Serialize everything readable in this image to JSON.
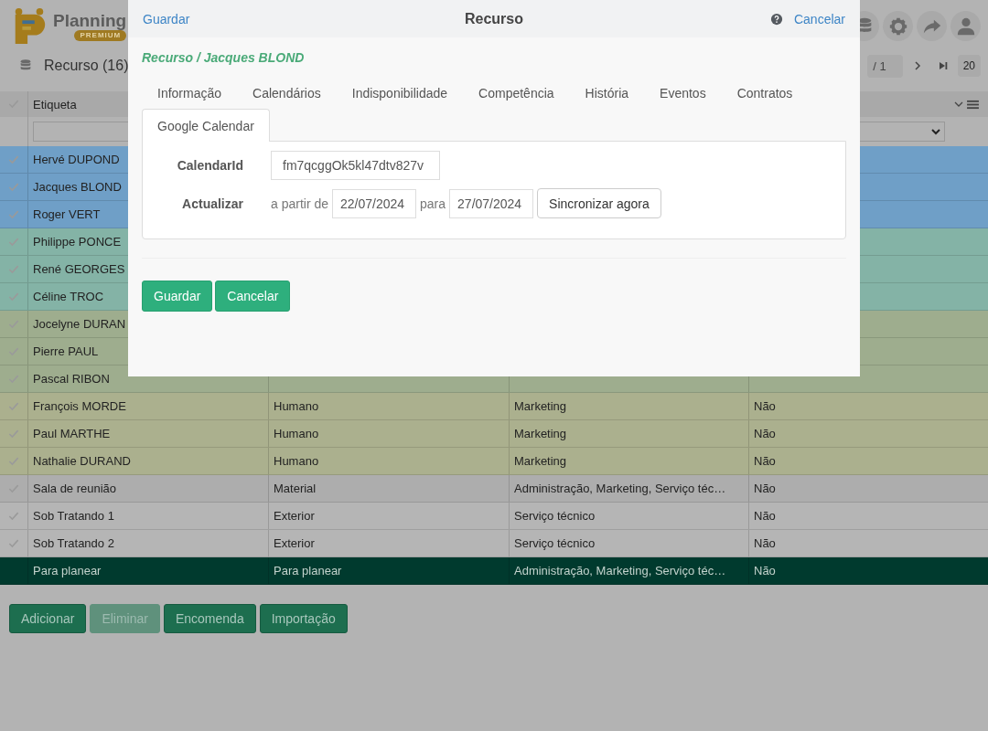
{
  "app": {
    "logo_name": "Planning",
    "logo_badge": "PREMIUM"
  },
  "toolbar": {
    "title": "Recurso (16)",
    "page_total": "/ 1",
    "page_size": "20"
  },
  "table": {
    "columns": [
      "Etiqueta"
    ],
    "rows": [
      {
        "cells": [
          "Hervé DUPOND"
        ],
        "color": "#6f9fc7",
        "kind": "resource"
      },
      {
        "cells": [
          "Jacques BLOND"
        ],
        "color": "#6f9fc7",
        "kind": "resource"
      },
      {
        "cells": [
          "Roger VERT"
        ],
        "color": "#6f9fc7",
        "kind": "resource"
      },
      {
        "cells": [
          "Philippe PONCE"
        ],
        "color": "#84b3a6",
        "kind": "resource"
      },
      {
        "cells": [
          "René GEORGES"
        ],
        "color": "#84b3a6",
        "kind": "resource"
      },
      {
        "cells": [
          "Céline TROC"
        ],
        "color": "#84b3a6",
        "kind": "resource"
      },
      {
        "cells": [
          "Jocelyne DURAN"
        ],
        "color": "#9ead8e",
        "kind": "resource"
      },
      {
        "cells": [
          "Pierre PAUL"
        ],
        "color": "#9ead8e",
        "kind": "resource"
      },
      {
        "cells": [
          "Pascal RIBON"
        ],
        "color": "#9ead8e",
        "kind": "resource"
      },
      {
        "cells": [
          "François MORDE",
          "Humano",
          "Marketing",
          "Não"
        ],
        "color": "#abb08e",
        "kind": "resource"
      },
      {
        "cells": [
          "Paul MARTHE",
          "Humano",
          "Marketing",
          "Não"
        ],
        "color": "#abb08e",
        "kind": "resource"
      },
      {
        "cells": [
          "Nathalie DURAND",
          "Humano",
          "Marketing",
          "Não"
        ],
        "color": "#abb08e",
        "kind": "resource"
      },
      {
        "cells": [
          "Sala de reunião",
          "Material",
          "Administração, Marketing, Serviço téc…",
          "Não"
        ],
        "color": "#adadad",
        "kind": "resource"
      },
      {
        "cells": [
          "Sob Tratando 1",
          "Exterior",
          "Serviço técnico",
          "Não"
        ],
        "color": "#b5b5b5",
        "kind": "resource"
      },
      {
        "cells": [
          "Sob Tratando 2",
          "Exterior",
          "Serviço técnico",
          "Não"
        ],
        "color": "#b5b5b5",
        "kind": "resource"
      },
      {
        "cells": [
          "Para planear",
          "Para planear",
          "Administração, Marketing, Serviço téc…",
          "Não"
        ],
        "color": "#003a2e",
        "kind": "group"
      }
    ]
  },
  "actions": [
    {
      "label": "Adicionar",
      "disabled": false
    },
    {
      "label": "Eliminar",
      "disabled": true
    },
    {
      "label": "Encomenda",
      "disabled": false
    },
    {
      "label": "Importação",
      "disabled": false
    }
  ],
  "modal": {
    "save_link": "Guardar",
    "title": "Recurso",
    "cancel_link": "Cancelar",
    "breadcrumb": "Recurso / Jacques BLOND",
    "tabs": [
      {
        "label": "Informação",
        "selected": false
      },
      {
        "label": "Calendários",
        "selected": false
      },
      {
        "label": "Indisponibilidade",
        "selected": false
      },
      {
        "label": "Competência",
        "selected": false
      },
      {
        "label": "História",
        "selected": false
      },
      {
        "label": "Eventos",
        "selected": false
      },
      {
        "label": "Contratos",
        "selected": false
      },
      {
        "label": "Google Calendar",
        "selected": true
      }
    ],
    "form": {
      "calendar_label": "CalendarId",
      "calendar_value": "fm7qcggOk5kl47dtv827v",
      "update_label": "Actualizar",
      "from_label": "a partir de",
      "from_date": "22/07/2024",
      "to_label": "para",
      "to_date": "27/07/2024",
      "sync_button": "Sincronizar agora"
    },
    "buttons": [
      "Guardar",
      "Cancelar"
    ]
  }
}
